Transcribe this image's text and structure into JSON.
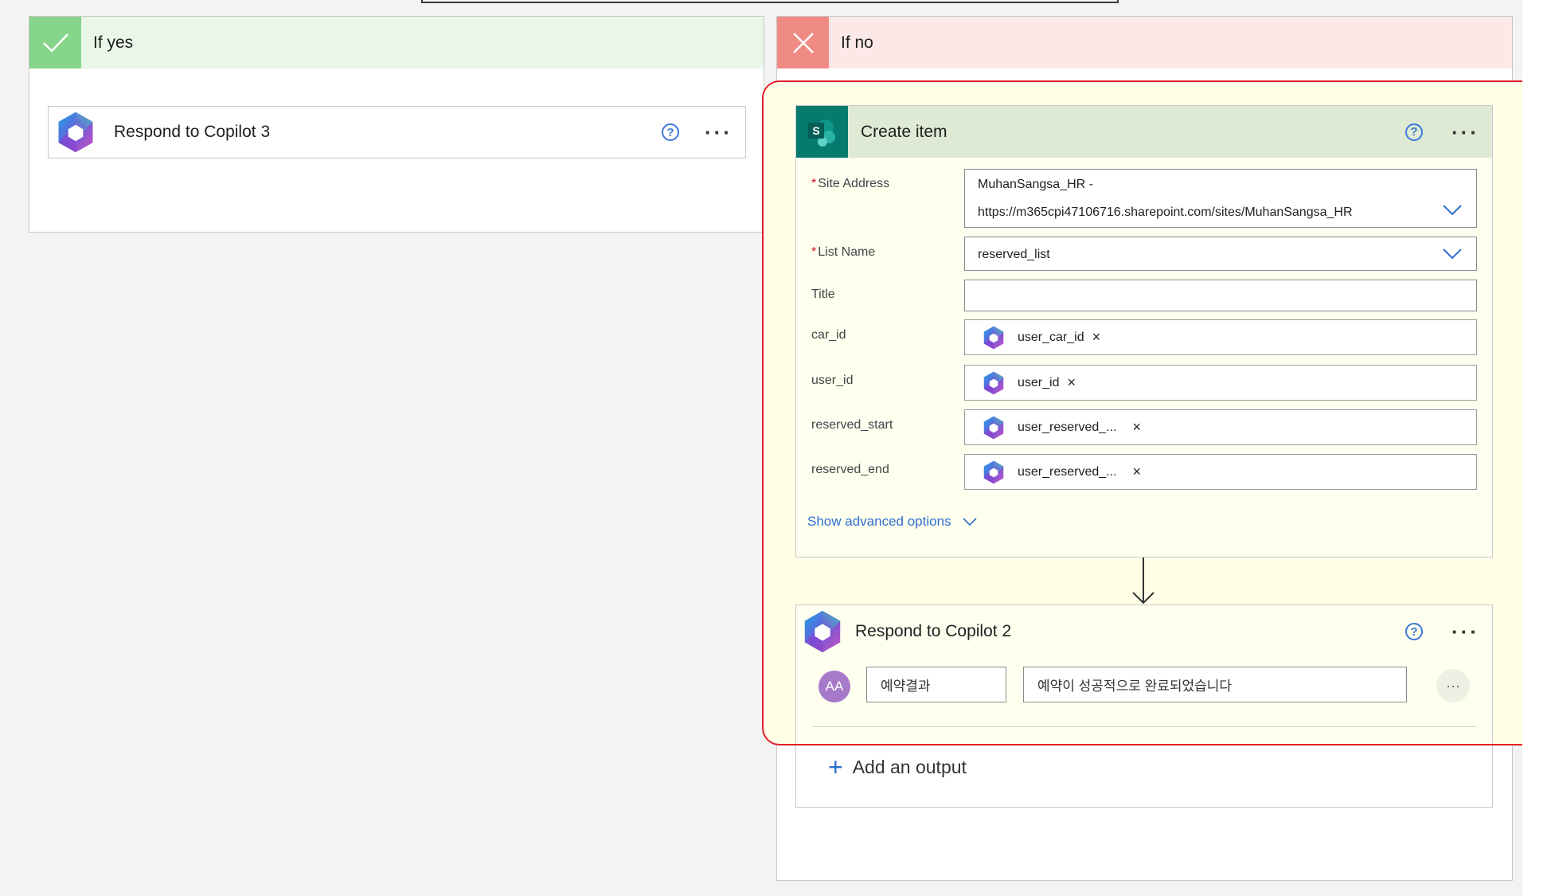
{
  "branches": {
    "yes": {
      "title": "If yes"
    },
    "no": {
      "title": "If no"
    }
  },
  "yes_card": {
    "title": "Respond to Copilot 3"
  },
  "create_item": {
    "title": "Create item",
    "fields": {
      "site_address": {
        "label": "Site Address",
        "value_line1": "MuhanSangsa_HR -",
        "value_line2": "https://m365cpi47106716.sharepoint.com/sites/MuhanSangsa_HR"
      },
      "list_name": {
        "label": "List Name",
        "value": "reserved_list"
      },
      "title": {
        "label": "Title",
        "value": ""
      },
      "car_id": {
        "label": "car_id",
        "token": "user_car_id"
      },
      "user_id": {
        "label": "user_id",
        "token": "user_id"
      },
      "reserved_start": {
        "label": "reserved_start",
        "token": "user_reserved_..."
      },
      "reserved_end": {
        "label": "reserved_end",
        "token": "user_reserved_..."
      }
    },
    "advanced": "Show advanced options"
  },
  "respond2": {
    "title": "Respond to Copilot 2",
    "avatar": "AA",
    "output_name": "예약결과",
    "output_value": "예약이 성공적으로 완료되었습니다",
    "add_output": "Add an output"
  },
  "icons": {
    "check": "check-icon",
    "close": "close-icon",
    "help": "help-icon",
    "more": "more-icon",
    "copilot": "copilot-icon",
    "sharepoint": "sharepoint-icon",
    "chevron": "chevron-down-icon",
    "arrow": "arrow-down-icon",
    "plus": "plus-icon"
  },
  "colors": {
    "yes_header": "#e8f7e8",
    "yes_icon_bg": "#86d58a",
    "no_header": "#fde8e8",
    "no_icon_bg": "#f08b84",
    "sharepoint": "#067a6f",
    "highlight": "#e0202a",
    "link": "#2f6fcf",
    "avatar": "#a77ac9"
  },
  "labels": {
    "help": "?",
    "more": "···",
    "x": "×",
    "plus": "+",
    "dots": "···"
  }
}
